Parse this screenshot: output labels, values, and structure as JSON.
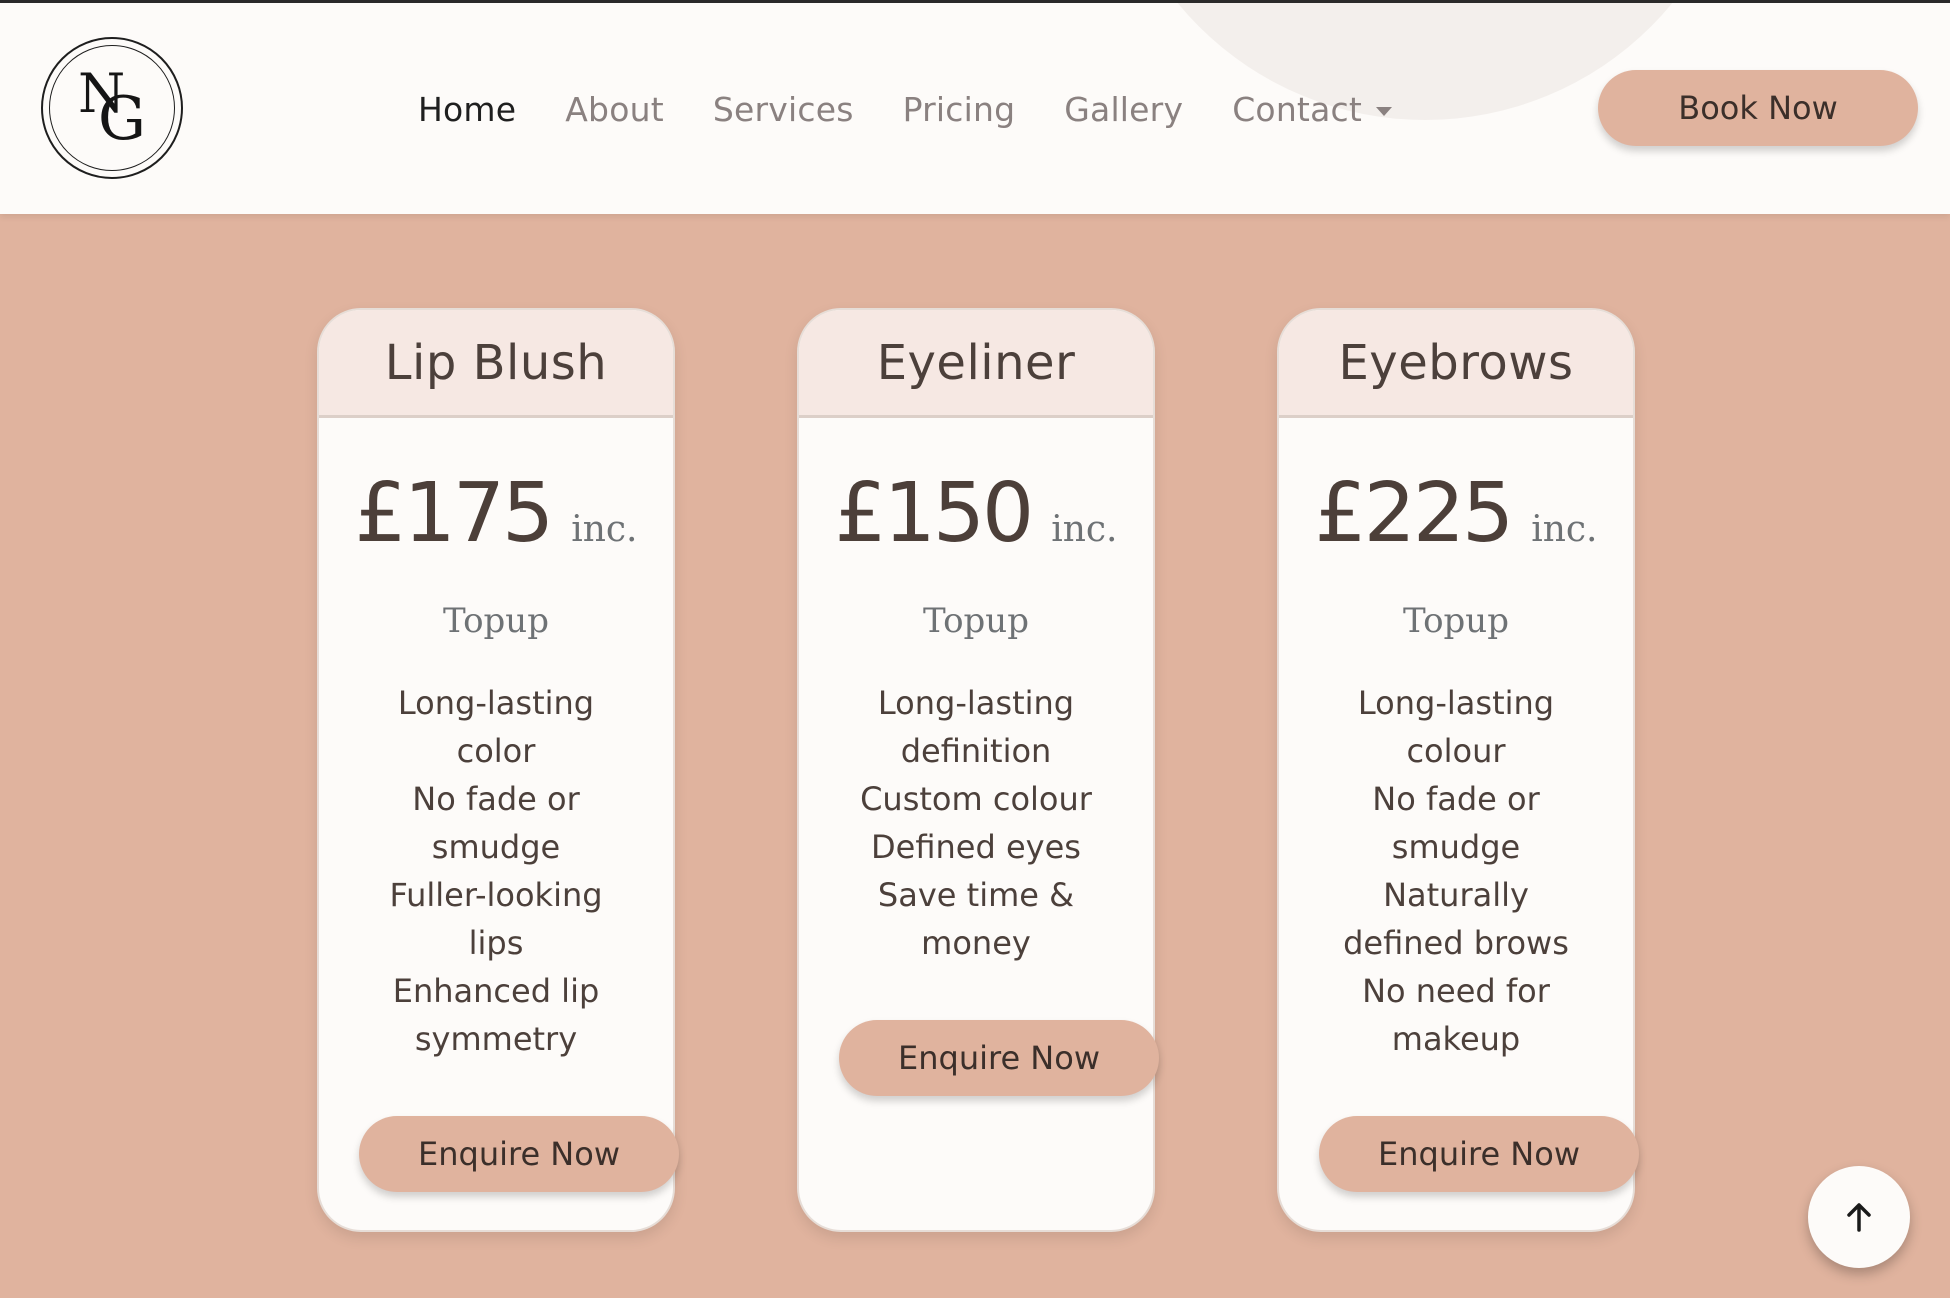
{
  "logo": {
    "letter_1": "N",
    "letter_2": "G"
  },
  "nav": {
    "items": [
      {
        "label": "Home",
        "active": true
      },
      {
        "label": "About",
        "active": false
      },
      {
        "label": "Services",
        "active": false
      },
      {
        "label": "Pricing",
        "active": false
      },
      {
        "label": "Gallery",
        "active": false
      },
      {
        "label": "Contact",
        "active": false,
        "has_dropdown": true
      }
    ],
    "book_label": "Book Now"
  },
  "cards": [
    {
      "title": "Lip Blush",
      "price": "£175",
      "inc": "inc.",
      "subtitle": "Topup",
      "features": [
        "Long-lasting",
        "color",
        "No fade or",
        "smudge",
        "Fuller-looking",
        "lips",
        "Enhanced lip",
        "symmetry"
      ],
      "button": "Enquire Now"
    },
    {
      "title": "Eyeliner",
      "price": "£150",
      "inc": "inc.",
      "subtitle": "Topup",
      "features": [
        "Long-lasting",
        "definition",
        "Custom colour",
        "Defined eyes",
        "Save time &",
        "money"
      ],
      "button": "Enquire Now"
    },
    {
      "title": "Eyebrows",
      "price": "£225",
      "inc": "inc.",
      "subtitle": "Topup",
      "features": [
        "Long-lasting",
        "colour",
        "No fade or",
        "smudge",
        "Naturally",
        "defined brows",
        "No need for",
        "makeup"
      ],
      "button": "Enquire Now"
    }
  ],
  "colors": {
    "page_bg": "#e0b39e",
    "header_bg": "#fdfbf9",
    "card_bg": "#fdfbf9",
    "card_head_bg": "#f6e8e3",
    "button_bg": "#e0b39e",
    "text_dark": "#4c403b"
  },
  "icons": {
    "back_to_top": "arrow-up-icon",
    "dropdown": "caret-down-icon"
  }
}
